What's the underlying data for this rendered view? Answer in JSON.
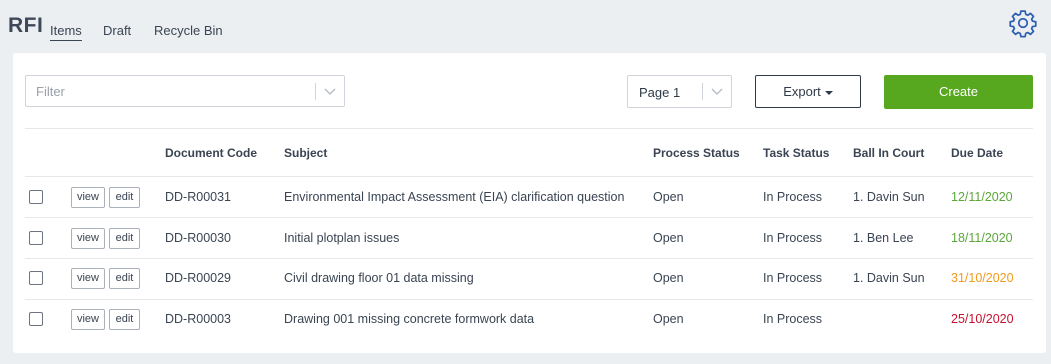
{
  "header": {
    "title": "RFI",
    "tabs": [
      {
        "label": "Items",
        "active": true
      },
      {
        "label": "Draft",
        "active": false
      },
      {
        "label": "Recycle Bin",
        "active": false
      }
    ],
    "settings_icon": "gear-icon"
  },
  "toolbar": {
    "filter_placeholder": "Filter",
    "page_value": "Page 1",
    "export_label": "Export",
    "create_label": "Create"
  },
  "table": {
    "columns": [
      "Document Code",
      "Subject",
      "Process Status",
      "Task Status",
      "Ball In Court",
      "Due Date"
    ],
    "view_label": "view",
    "edit_label": "edit",
    "rows": [
      {
        "code": "DD-R00031",
        "subject": "Environmental Impact Assessment (EIA) clarification question",
        "process_status": "Open",
        "task_status": "In Process",
        "ball_in_court": "1. Davin Sun",
        "due_date": "12/11/2020",
        "due_color": "#5ca63a"
      },
      {
        "code": "DD-R00030",
        "subject": "Initial plotplan issues",
        "process_status": "Open",
        "task_status": "In Process",
        "ball_in_court": "1. Ben Lee",
        "due_date": "18/11/2020",
        "due_color": "#5ca63a"
      },
      {
        "code": "DD-R00029",
        "subject": "Civil drawing floor 01 data missing",
        "process_status": "Open",
        "task_status": "In Process",
        "ball_in_court": "1. Davin Sun",
        "due_date": "31/10/2020",
        "due_color": "#f19a1c"
      },
      {
        "code": "DD-R00003",
        "subject": "Drawing 001 missing concrete formwork data",
        "process_status": "Open",
        "task_status": "In Process",
        "ball_in_court": "",
        "due_date": "25/10/2020",
        "due_color": "#c8102e"
      }
    ]
  },
  "colors": {
    "accent_create": "#57a81f",
    "settings_icon": "#2e5fb0",
    "due_ok": "#5ca63a",
    "due_warning": "#f19a1c",
    "due_overdue": "#c8102e"
  }
}
